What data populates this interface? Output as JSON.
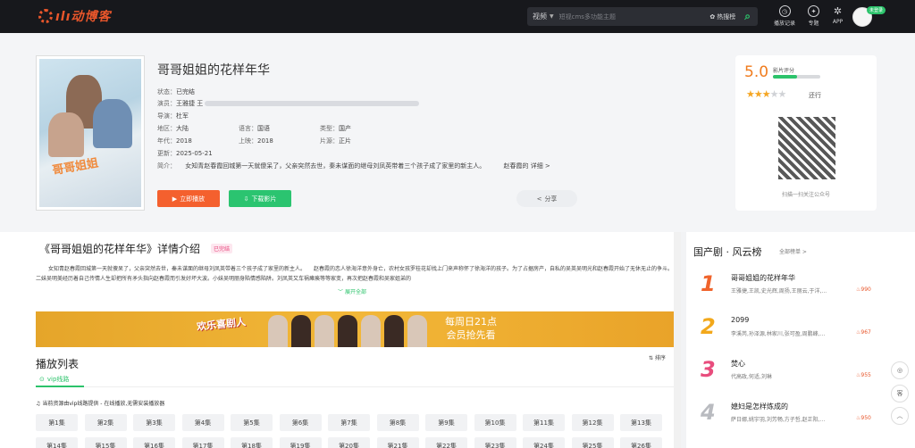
{
  "header": {
    "logo_text": "ılı动博客",
    "search_type": "视频",
    "search_placeholder": "短视cms多功能主题",
    "hotsearch": "热搜榜",
    "nav": [
      {
        "label": "播放记录",
        "icon": "clock-icon",
        "glyph": "◷"
      },
      {
        "label": "专题",
        "icon": "globe-icon",
        "glyph": "✦"
      },
      {
        "label": "APP",
        "icon": "app-icon",
        "glyph": "✲"
      }
    ],
    "vip_badge": "未登录"
  },
  "movie": {
    "title": "哥哥姐姐的花样年华",
    "status_k": "状态：",
    "status": "已完结",
    "actors_k": "演员：",
    "actors": "王雅捷 王",
    "director_k": "导演：",
    "director": "杜军",
    "region_k": "地区：",
    "region": "大陆",
    "lang_k": "语言：",
    "lang": "国语",
    "type_k": "类型：",
    "type": "国产",
    "year_k": "年代：",
    "year": "2018",
    "release_k": "上映：",
    "release": "2018",
    "source_k": "片源：",
    "source": "正片",
    "update_k": "更新：",
    "update": "2025-05-21",
    "intro_k": "简介：",
    "intro": "女知青赵春霞回城第一天就傻呆了，父亲突然去世，秦未谋面的继母刘凤英带着三个孩子成了家里的新主人。",
    "intro_more": "赵春霞的",
    "detail_link": "详细 >",
    "play_btn": "立即播放",
    "download_btn": "下载影片",
    "share_btn": "分享"
  },
  "rating": {
    "score": "5.0",
    "label": "影片评分",
    "fraction": 0.5,
    "stars": 3,
    "rate_text": "还行",
    "qr_caption": "扫描一扫关注公众号"
  },
  "detail": {
    "title": "《哥哥姐姐的花样年华》详情介绍",
    "tag": "已完结",
    "desc": "女知青赵春霞回城第一天就傻呆了，父亲突然去世，秦未谋面的继母刘凤英带着三个孩子成了家里的新主人。　　赵春霞的恋人徐海洋意外身亡，农村女孩罗桂花却找上门来声称怀了徐海洋的孩子。为了占据房产，自私的吴英吴明光和赵春霞开始了无休无止的争斗。二妹吴明美经历着自己传情人生却把所有矛头指向赵春霞而引发好坏大波。小妹吴明丽身陷情感陷阱。刘凤英又车祸瘫痪等等家变，再次把赵春霞和吴家姐弟的",
    "expand": "展开全部"
  },
  "banner": {
    "left": "欢乐喜剧人",
    "right_1": "每周日21点",
    "right_2": "会员抢先看"
  },
  "playlist": {
    "title": "播放列表",
    "sort": "⇅ 排序",
    "tab": "vip线路",
    "notice": "当前资源由vip线路提供 - 在线播放,无需安装播放器",
    "episodes": [
      "第1集",
      "第2集",
      "第3集",
      "第4集",
      "第5集",
      "第6集",
      "第7集",
      "第8集",
      "第9集",
      "第10集",
      "第11集",
      "第12集",
      "第13集",
      "第14集",
      "第15集",
      "第16集",
      "第17集",
      "第18集",
      "第19集",
      "第20集",
      "第21集",
      "第22集",
      "第23集",
      "第24集",
      "第25集",
      "第26集"
    ]
  },
  "sidebar": {
    "title": "国产剧 · 风云榜",
    "more": "全部榜单 >",
    "ranks": [
      {
        "num": "1",
        "name": "哥哥姐姐的花样年华",
        "cast": "王雅捷,王凯,史光辉,周扬,王丽云,于洋,...",
        "heat": "990",
        "color": "#f0642c"
      },
      {
        "num": "2",
        "name": "2099",
        "cast": "李溪芮,孙泽源,林家川,张可盈,周鹏峰,...",
        "heat": "967",
        "color": "#f2a81b"
      },
      {
        "num": "3",
        "name": "焚心",
        "cast": "代高政,何适,刘琳",
        "heat": "955",
        "color": "#e84d7d"
      },
      {
        "num": "4",
        "name": "媳妇是怎样炼成的",
        "cast": "萨日娜,姚宇羽,刘芳畅,方子哲,赵正阳,...",
        "heat": "950",
        "color": "#b9bbc0"
      }
    ]
  },
  "fabs": [
    "◎",
    "客",
    "︿"
  ]
}
